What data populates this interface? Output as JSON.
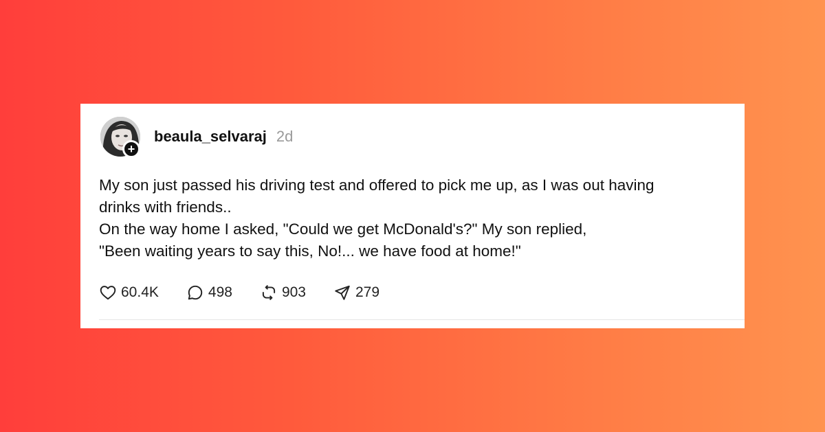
{
  "post": {
    "username": "beaula_selvaraj",
    "timestamp": "2d",
    "follow_badge": "+",
    "text_lines": [
      "My son just passed his driving test and offered to pick me up, as I was out having",
      "drinks with friends..",
      "On the way home I asked, \"Could we get McDonald's?\" My son replied,",
      "\"Been waiting years to say this, No!... we have food at home!\""
    ],
    "stats": {
      "likes": "60.4K",
      "replies": "498",
      "reposts": "903",
      "shares": "279"
    },
    "icons": [
      "heart-icon",
      "comment-icon",
      "repost-icon",
      "share-icon"
    ]
  },
  "colors": {
    "background_left": "#ff3e3b",
    "background_right": "#ff934f",
    "card": "#ffffff",
    "timestamp": "#9a9a9a"
  }
}
